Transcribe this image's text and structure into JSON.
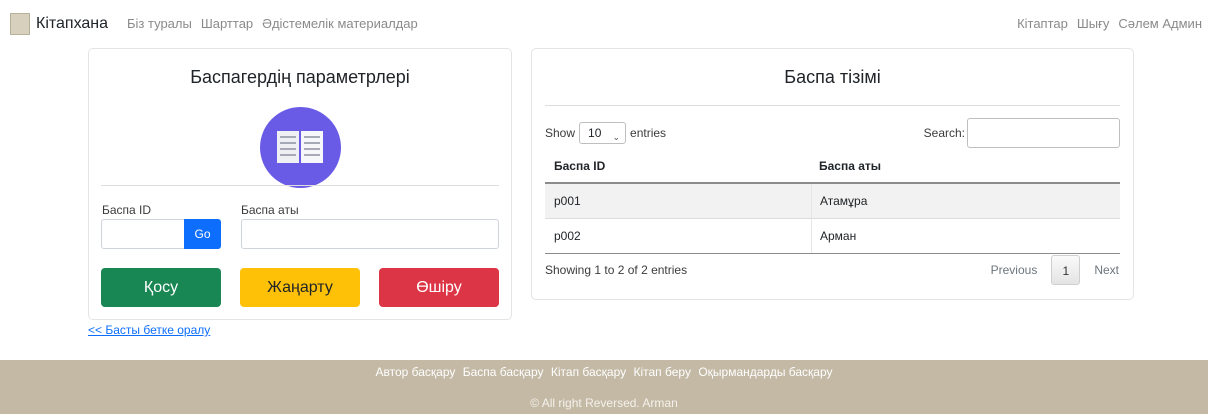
{
  "navbar": {
    "brand": "Кітапхана",
    "left_links": [
      "Біз туралы",
      "Шарттар",
      "Әдістемелік материалдар"
    ],
    "right_links": [
      "Кітаптар",
      "Шығу",
      "Сәлем Админ"
    ]
  },
  "form": {
    "title": "Баспагердің параметрлері",
    "id_label": "Баспа ID",
    "go_label": "Go",
    "name_label": "Баспа аты",
    "id_value": "",
    "name_value": "",
    "add_label": "Қосу",
    "update_label": "Жаңарту",
    "delete_label": "Өшіру",
    "back_link": "<< Басты бетке оралу"
  },
  "list": {
    "title": "Баспа тізімі",
    "show_label": "Show",
    "entries_label": "entries",
    "page_size": "10",
    "search_label": "Search:",
    "search_value": "",
    "columns": [
      "Баспа ID",
      "Баспа аты"
    ],
    "rows": [
      [
        "p001",
        "Атамұра"
      ],
      [
        "p002",
        "Арман"
      ]
    ],
    "info": "Showing 1 to 2 of 2 entries",
    "prev_label": "Previous",
    "current_page": "1",
    "next_label": "Next"
  },
  "footer": {
    "links": [
      "Автор басқару",
      "Баспа басқару",
      "Кітап басқару",
      "Кітап беру",
      "Оқырмандарды басқару"
    ],
    "copyright": "© All right Reversed. Arman"
  },
  "colors": {
    "primary": "#0d6efd",
    "success": "#198754",
    "warning": "#ffc107",
    "danger": "#dc3545",
    "footer_bg": "#c3b9a5",
    "icon_bg": "#6a5be6"
  },
  "icons": {
    "brand": "book-icon",
    "publisher": "open-book-icon",
    "select": "chevron-down-icon"
  }
}
